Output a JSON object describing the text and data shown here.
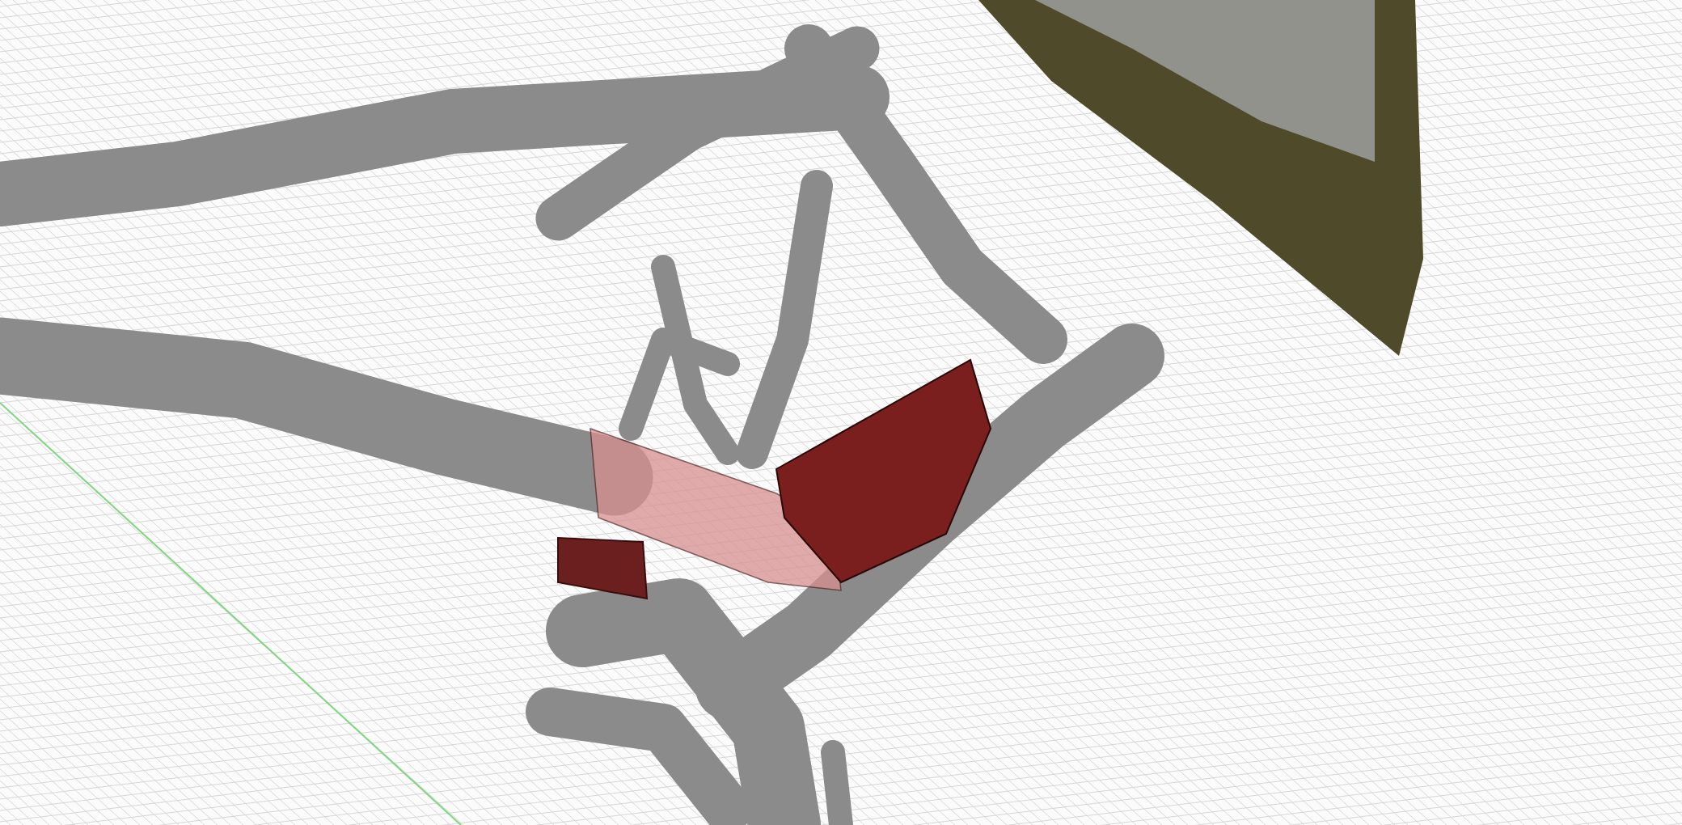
{
  "viewport": {
    "grid_visible": true,
    "axis_visible": true
  }
}
